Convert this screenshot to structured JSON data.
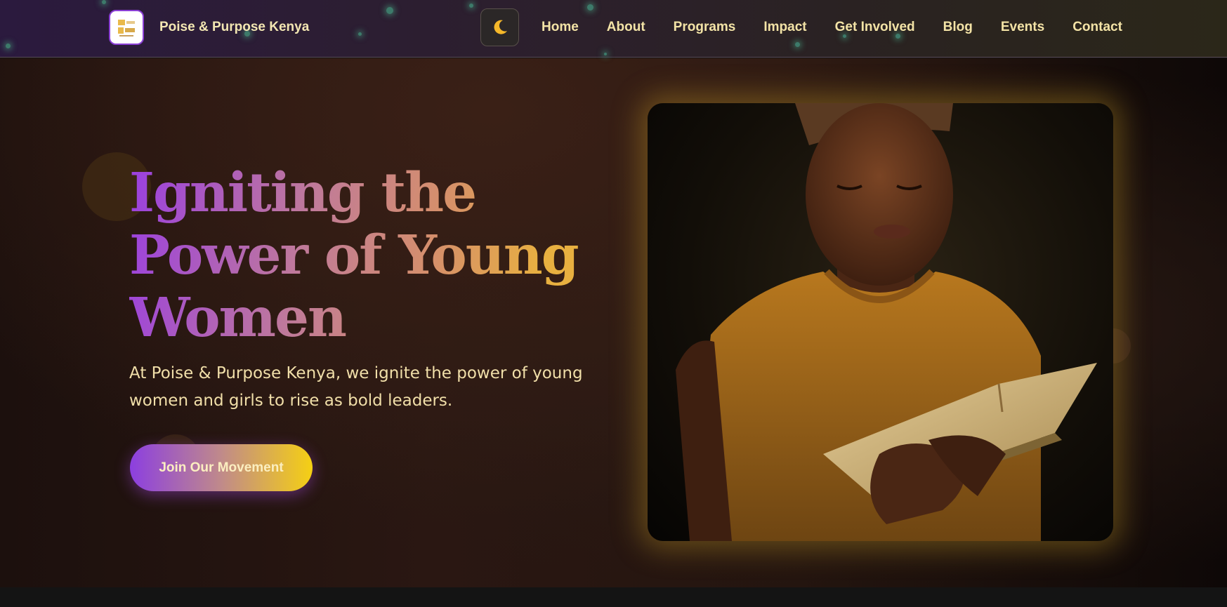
{
  "header": {
    "brand_name": "Poise & Purpose Kenya",
    "logo_icon": "organization-logo-icon",
    "theme_toggle_icon": "moon-icon",
    "nav": [
      "Home",
      "About",
      "Programs",
      "Impact",
      "Get Involved",
      "Blog",
      "Events",
      "Contact"
    ]
  },
  "hero": {
    "title_line1": "Igniting the",
    "title_line2": "Power of Young",
    "title_line3": "Women",
    "subtitle": "At Poise & Purpose Kenya, we ignite the power of young women and girls to rise as bold leaders.",
    "cta_label": "Join Our Movement",
    "image_alt": "Young woman reading a book"
  },
  "colors": {
    "accent_purple": "#8b3fd6",
    "accent_gold": "#f5d013",
    "text_cream": "#f3e3a6"
  }
}
